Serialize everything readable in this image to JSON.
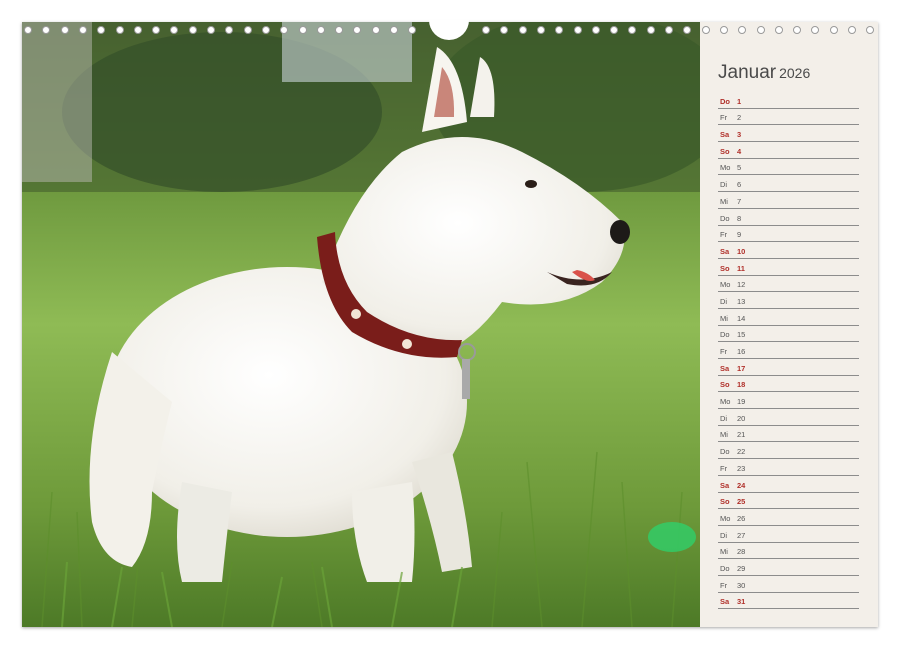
{
  "calendar": {
    "month": "Januar",
    "year": "2026",
    "days": [
      {
        "wd": "Do",
        "d": "1",
        "weekend": true
      },
      {
        "wd": "Fr",
        "d": "2",
        "weekend": false
      },
      {
        "wd": "Sa",
        "d": "3",
        "weekend": true
      },
      {
        "wd": "So",
        "d": "4",
        "weekend": true
      },
      {
        "wd": "Mo",
        "d": "5",
        "weekend": false
      },
      {
        "wd": "Di",
        "d": "6",
        "weekend": false
      },
      {
        "wd": "Mi",
        "d": "7",
        "weekend": false
      },
      {
        "wd": "Do",
        "d": "8",
        "weekend": false
      },
      {
        "wd": "Fr",
        "d": "9",
        "weekend": false
      },
      {
        "wd": "Sa",
        "d": "10",
        "weekend": true
      },
      {
        "wd": "So",
        "d": "11",
        "weekend": true
      },
      {
        "wd": "Mo",
        "d": "12",
        "weekend": false
      },
      {
        "wd": "Di",
        "d": "13",
        "weekend": false
      },
      {
        "wd": "Mi",
        "d": "14",
        "weekend": false
      },
      {
        "wd": "Do",
        "d": "15",
        "weekend": false
      },
      {
        "wd": "Fr",
        "d": "16",
        "weekend": false
      },
      {
        "wd": "Sa",
        "d": "17",
        "weekend": true
      },
      {
        "wd": "So",
        "d": "18",
        "weekend": true
      },
      {
        "wd": "Mo",
        "d": "19",
        "weekend": false
      },
      {
        "wd": "Di",
        "d": "20",
        "weekend": false
      },
      {
        "wd": "Mi",
        "d": "21",
        "weekend": false
      },
      {
        "wd": "Do",
        "d": "22",
        "weekend": false
      },
      {
        "wd": "Fr",
        "d": "23",
        "weekend": false
      },
      {
        "wd": "Sa",
        "d": "24",
        "weekend": true
      },
      {
        "wd": "So",
        "d": "25",
        "weekend": true
      },
      {
        "wd": "Mo",
        "d": "26",
        "weekend": false
      },
      {
        "wd": "Di",
        "d": "27",
        "weekend": false
      },
      {
        "wd": "Mi",
        "d": "28",
        "weekend": false
      },
      {
        "wd": "Do",
        "d": "29",
        "weekend": false
      },
      {
        "wd": "Fr",
        "d": "30",
        "weekend": false
      },
      {
        "wd": "Sa",
        "d": "31",
        "weekend": true
      }
    ]
  },
  "colors": {
    "weekend": "#b0302a",
    "weekday": "#555555",
    "panel": "#f3efe9"
  },
  "photo": {
    "subject": "west-highland-terrier"
  }
}
